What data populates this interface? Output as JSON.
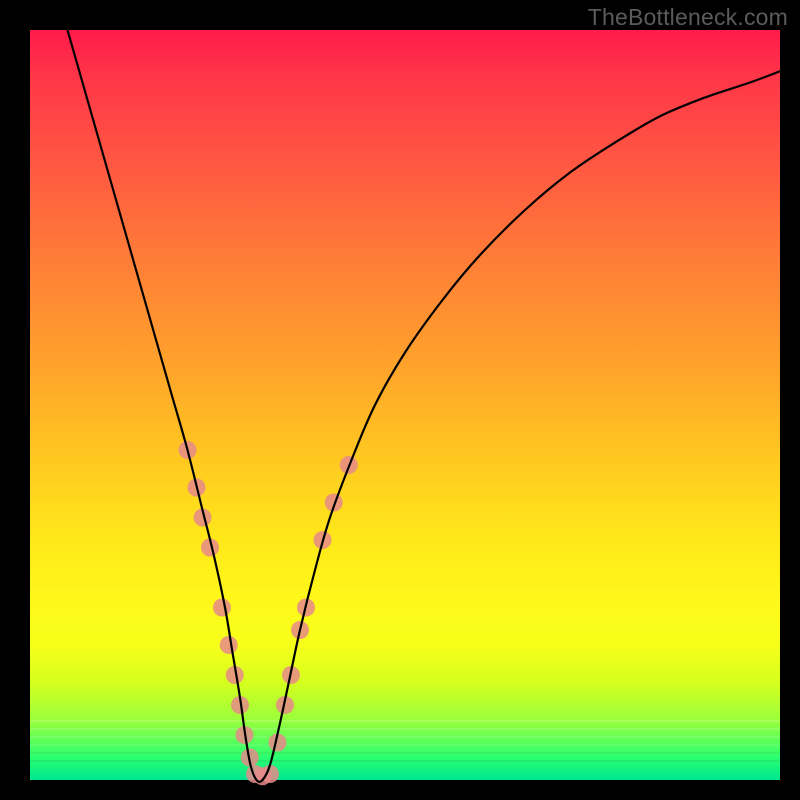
{
  "watermark": "TheBottleneck.com",
  "chart_data": {
    "type": "line",
    "title": "",
    "xlabel": "",
    "ylabel": "",
    "xlim": [
      0,
      100
    ],
    "ylim": [
      0,
      100
    ],
    "grid": false,
    "notes": "V-shaped bottleneck curve over a vertical red→green gradient. Minimum sits left of center. Pink dot markers cluster along the lower arms and bottom of the V. No axis ticks or numeric labels are rendered.",
    "series": [
      {
        "name": "bottleneck-curve",
        "color": "#000000",
        "x": [
          5,
          7,
          9,
          11,
          13,
          15,
          17,
          19,
          21,
          23,
          24.5,
          26,
          27,
          28,
          28.7,
          29.4,
          30.2,
          31,
          32,
          33.2,
          34.5,
          36,
          38,
          40,
          43,
          46,
          50,
          55,
          60,
          66,
          72,
          78,
          84,
          90,
          96,
          100
        ],
        "y": [
          100,
          93,
          86,
          79,
          72,
          65,
          58,
          51,
          44,
          36,
          30,
          23,
          17,
          11,
          6,
          2,
          0,
          0,
          2,
          7,
          13,
          20,
          28,
          35,
          43,
          50,
          57,
          64,
          70,
          76,
          81,
          85,
          88.5,
          91,
          93,
          94.5
        ]
      }
    ],
    "markers": {
      "name": "highlighted-points",
      "color": "#e68a8a",
      "radius_px": 9,
      "points": [
        {
          "x": 21.0,
          "y": 44
        },
        {
          "x": 22.2,
          "y": 39
        },
        {
          "x": 23.0,
          "y": 35
        },
        {
          "x": 24.0,
          "y": 31
        },
        {
          "x": 25.6,
          "y": 23
        },
        {
          "x": 26.5,
          "y": 18
        },
        {
          "x": 27.3,
          "y": 14
        },
        {
          "x": 28.0,
          "y": 10
        },
        {
          "x": 28.6,
          "y": 6
        },
        {
          "x": 29.3,
          "y": 3
        },
        {
          "x": 30.0,
          "y": 0.8
        },
        {
          "x": 31.0,
          "y": 0.5
        },
        {
          "x": 32.0,
          "y": 0.8
        },
        {
          "x": 33.0,
          "y": 5
        },
        {
          "x": 34.0,
          "y": 10
        },
        {
          "x": 34.8,
          "y": 14
        },
        {
          "x": 36.0,
          "y": 20
        },
        {
          "x": 36.8,
          "y": 23
        },
        {
          "x": 39.0,
          "y": 32
        },
        {
          "x": 40.5,
          "y": 37
        },
        {
          "x": 42.5,
          "y": 42
        }
      ]
    },
    "gradient_stops": [
      {
        "pct": 0,
        "color": "#ff1a4b"
      },
      {
        "pct": 18,
        "color": "#ff5842"
      },
      {
        "pct": 46,
        "color": "#ffa62a"
      },
      {
        "pct": 70,
        "color": "#ffe81a"
      },
      {
        "pct": 88,
        "color": "#c0ff28"
      },
      {
        "pct": 100,
        "color": "#00e690"
      }
    ]
  }
}
